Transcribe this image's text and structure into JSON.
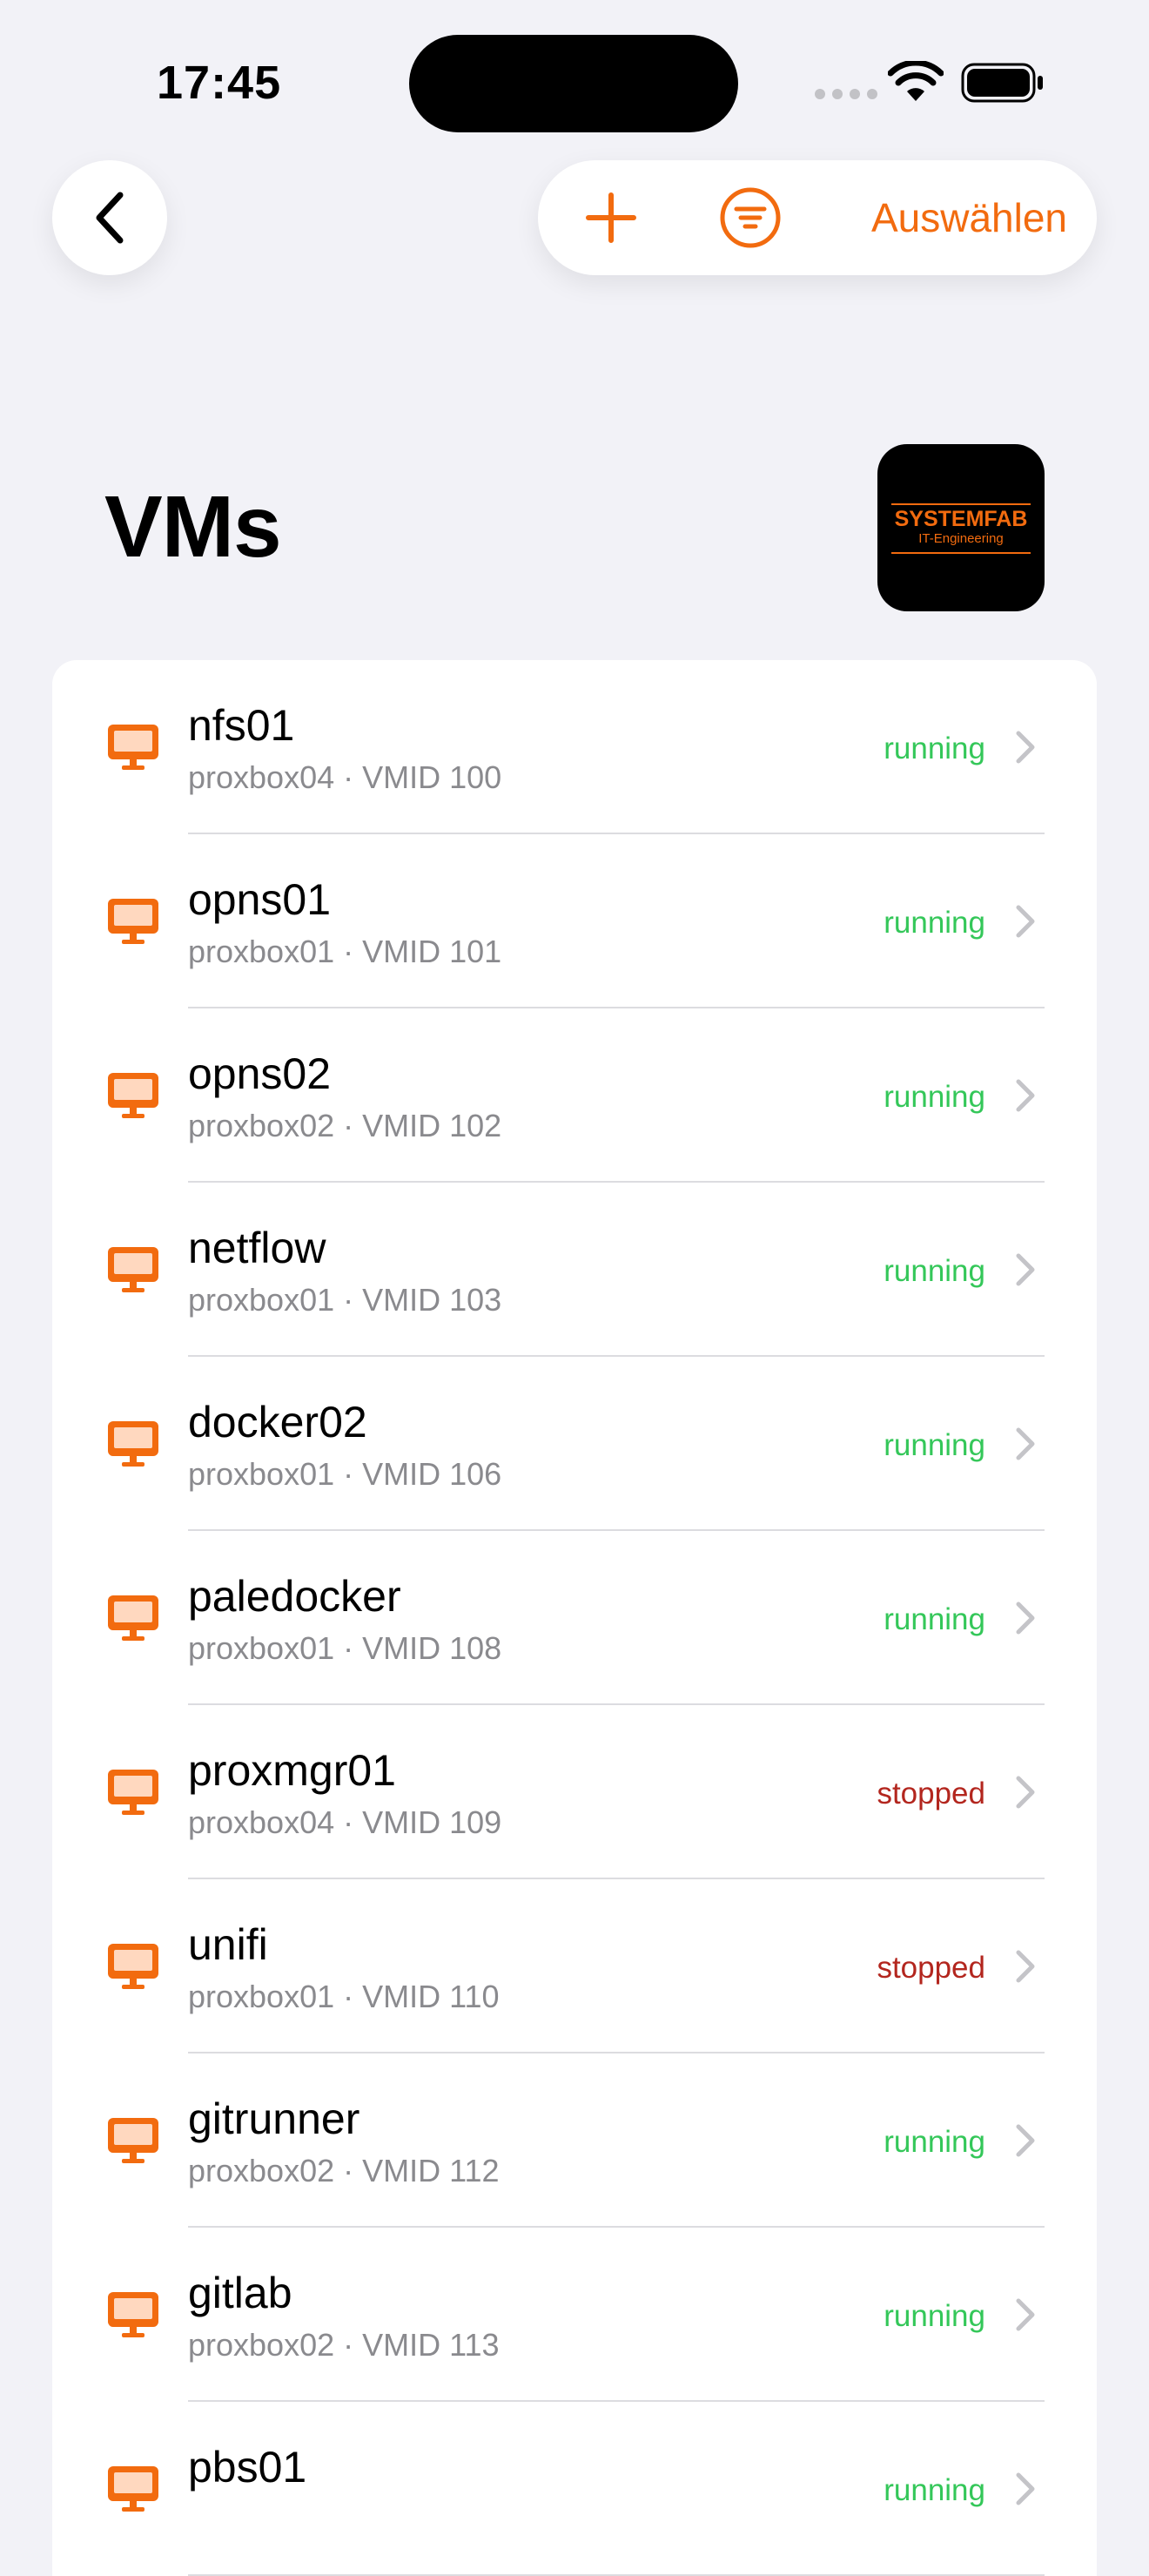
{
  "status_bar": {
    "time": "17:45"
  },
  "toolbar": {
    "back_icon": "chevron-left-icon",
    "add_icon": "plus-icon",
    "filter_icon": "filter-circle-icon",
    "select_label": "Auswählen"
  },
  "header": {
    "title": "VMs",
    "logo_name": "SYSTEMFAB",
    "logo_tagline": "IT-Engineering"
  },
  "colors": {
    "accent": "#f26b0f",
    "running": "#34c759",
    "stopped": "#b3261e",
    "background": "#f2f2f7"
  },
  "vms": [
    {
      "name": "nfs01",
      "subtitle": "proxbox04 · VMID 100",
      "status": "running"
    },
    {
      "name": "opns01",
      "subtitle": "proxbox01 · VMID 101",
      "status": "running"
    },
    {
      "name": "opns02",
      "subtitle": "proxbox02 · VMID 102",
      "status": "running"
    },
    {
      "name": "netflow",
      "subtitle": "proxbox01 · VMID 103",
      "status": "running"
    },
    {
      "name": "docker02",
      "subtitle": "proxbox01 · VMID 106",
      "status": "running"
    },
    {
      "name": "paledocker",
      "subtitle": "proxbox01 · VMID 108",
      "status": "running"
    },
    {
      "name": "proxmgr01",
      "subtitle": "proxbox04 · VMID 109",
      "status": "stopped"
    },
    {
      "name": "unifi",
      "subtitle": "proxbox01 · VMID 110",
      "status": "stopped"
    },
    {
      "name": "gitrunner",
      "subtitle": "proxbox02 · VMID 112",
      "status": "running"
    },
    {
      "name": "gitlab",
      "subtitle": "proxbox02 · VMID 113",
      "status": "running"
    },
    {
      "name": "pbs01",
      "subtitle": "",
      "status": "running"
    }
  ]
}
